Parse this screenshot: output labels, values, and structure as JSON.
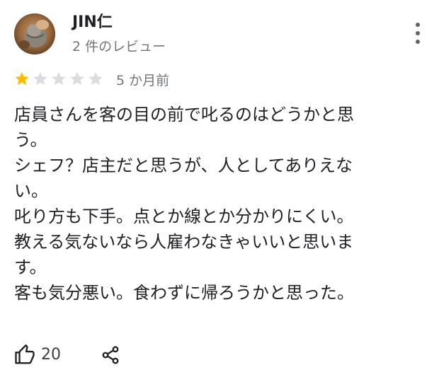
{
  "reviewer": {
    "name": "JIN仁",
    "review_count": "2 件のレビュー",
    "avatar_icon": "avatar-photo"
  },
  "rating": {
    "value": 1,
    "max": 5,
    "filled_color": "#fbbc04",
    "empty_color": "#dadce0"
  },
  "time": "5 か月前",
  "review_lines": [
    "店員さんを客の目の前で叱るのはどうかと思",
    "う。",
    "シェフ？店主だと思うが、人としてありえな",
    "い。",
    "叱り方も下手。点とか線とか分かりにくい。",
    "教える気ないなら人雇わなきゃいいと思いま",
    "す。",
    "客も気分悪い。食わずに帰ろうかと思った。"
  ],
  "actions": {
    "like_count": "20",
    "like_icon": "thumb-up-icon",
    "share_icon": "share-icon",
    "more_icon": "more-vert-icon"
  }
}
